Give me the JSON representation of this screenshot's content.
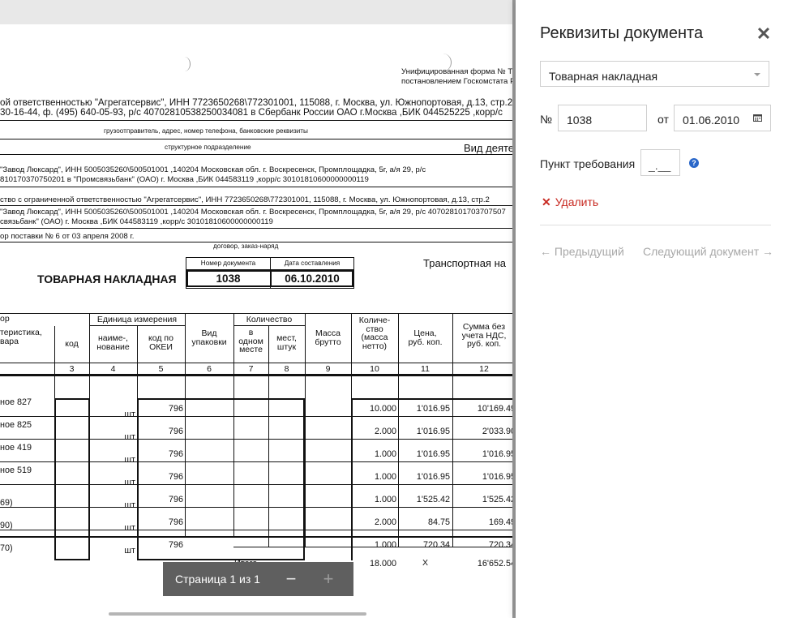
{
  "panel": {
    "title": "Реквизиты документа",
    "close_icon": "close-icon",
    "doc_type": "Товарная накладная",
    "number_label": "№",
    "number_value": "1038",
    "date_label": "от",
    "date_value": "01.06.2010",
    "requirement_label": "Пункт требования",
    "requirement_placeholder": "_.__",
    "delete_label": "Удалить",
    "prev_label": "← Предыдущий",
    "next_label": "Следующий документ →",
    "accent_red": "#c82a22",
    "accent_blue": "#2a67c9"
  },
  "pager": {
    "label": "Страница 1 из 1",
    "zoom_out": "−",
    "zoom_in": "+"
  },
  "scan": {
    "unified_form": "Унифицированная форма № Т",
    "approved": "постановлением Госкомстата Р",
    "shipper_line1": "ой ответственностью \"Агрегатсервис\", ИНН 7723650268\\772301001, 115088, г. Москва, ул. Южнопортовая, д.13, стр.2,",
    "shipper_line2": "30-16-44, ф. (495) 640-05-93, р/с 40702810538250034081 в Сбербанк России ОАО г.Москва ,БИК 044525225 ,корр/с",
    "shipper_caption": "грузоотправитель, адрес, номер телефона, банковские реквизиты",
    "subdivision_caption": "структурное подразделение",
    "activity": "Вид деяте",
    "consignee_line1": "\"Завод Люксард\", ИНН 5005035260\\500501001 ,140204  Московская обл. г. Воскресенск, Промплощадка, 5г, а/я 29, р/с",
    "consignee_line2": "810170370750201 в \"Промсвязьбанк\" (ОАО) г. Москва ,БИК 044583119 ,корр/с 30101810600000000119",
    "supplier_line1": "ство с ограниченной ответственностью \"Агрегатсервис\", ИНН 7723650268\\772301001, 115088, г. Москва, ул. Южнопортовая, д.13, стр.2",
    "payer_line1": "\"Завод Люксард\", ИНН 5005035260\\500501001 ,140204  Московская обл. г. Воскресенск, Промплощадка, 5г, а/я 29, р/с 407028101703707507",
    "payer_line2": "связьбанк\" (ОАО) г. Москва ,БИК 044583119 ,корр/с 30101810600000000119",
    "basis": "ор поставки № 6 от 03 апреля 2008 г.",
    "basis_caption": "договор, заказ-наряд",
    "doc_title": "ТОВАРНАЯ НАКЛАДНАЯ",
    "doc_number_header": "Номер документа",
    "doc_date_header": "Дата составления",
    "doc_number": "1038",
    "doc_date": "06.10.2010",
    "transport": "Транспортная на",
    "headers": {
      "col1_top": "ор",
      "col1": "теристика,\nвара",
      "kod": "код",
      "unit_group": "Единица измерения",
      "unit_name": "наиме-,\nнование",
      "okei": "код по\nОКЕИ",
      "pack": "Вид\nупаковки",
      "qty_group": "Количество",
      "per_place": "в\nодном\nместе",
      "places": "мест,\nштук",
      "gross": "Масса\nбрутто",
      "net": "Количе-\nство\n(масса\nнетто)",
      "price": "Цена,\nруб. коп.",
      "sum": "Сумма без\nучета НДС,\nруб. коп."
    },
    "col_numbers": [
      "3",
      "4",
      "5",
      "6",
      "7",
      "8",
      "9",
      "10",
      "11",
      "12"
    ],
    "rows": [
      {
        "name": "ное  827",
        "unit": "шт",
        "okei": "796",
        "qty": "10.000",
        "price": "1'016.95",
        "sum": "10'169.49"
      },
      {
        "name": "ное  825",
        "unit": "шт",
        "okei": "796",
        "qty": "2.000",
        "price": "1'016.95",
        "sum": "2'033.90"
      },
      {
        "name": "ное  419",
        "unit": "шт",
        "okei": "796",
        "qty": "1.000",
        "price": "1'016.95",
        "sum": "1'016.95"
      },
      {
        "name": "ное  519",
        "unit": "шт",
        "okei": "796",
        "qty": "1.000",
        "price": "1'016.95",
        "sum": "1'016.95"
      },
      {
        "name": "69)",
        "unit": "шт",
        "okei": "796",
        "qty": "1.000",
        "price": "1'525.42",
        "sum": "1'525.42"
      },
      {
        "name": "90)",
        "unit": "шт",
        "okei": "796",
        "qty": "2.000",
        "price": "84.75",
        "sum": "169.49"
      },
      {
        "name": "70)",
        "unit": "шт",
        "okei": "796",
        "qty": "1.000",
        "price": "720.34",
        "sum": "720.34"
      }
    ],
    "total_label": "Итого",
    "total_qty": "18.000",
    "total_price": "X",
    "total_sum": "16'652.54"
  }
}
